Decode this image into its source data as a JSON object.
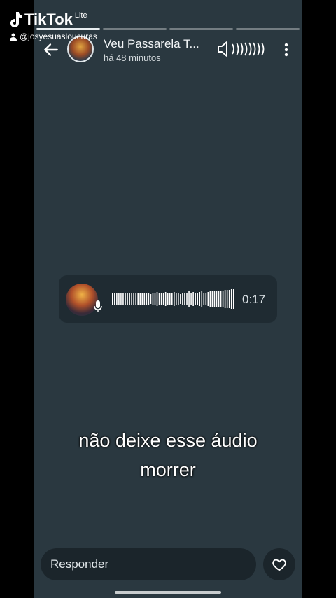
{
  "watermark": {
    "brand": "TikTok",
    "variant": "Lite",
    "username": "@josyesuasloucuras"
  },
  "story": {
    "segments_total": 4,
    "segments_done": 1,
    "header": {
      "title": "Veu Passarela T...",
      "time_ago": "há 48 minutos"
    },
    "audio": {
      "duration": "0:17"
    },
    "caption_line1": "não deixe esse áudio",
    "caption_line2": "morrer",
    "reply_placeholder": "Responder"
  },
  "colors": {
    "background": "#2a3840",
    "card": "#1f2b32",
    "text": "#f2f5f7"
  },
  "icons": [
    "back-arrow-icon",
    "volume-icon",
    "more-vertical-icon",
    "mic-icon",
    "heart-icon",
    "tiktok-note-icon",
    "person-icon"
  ]
}
